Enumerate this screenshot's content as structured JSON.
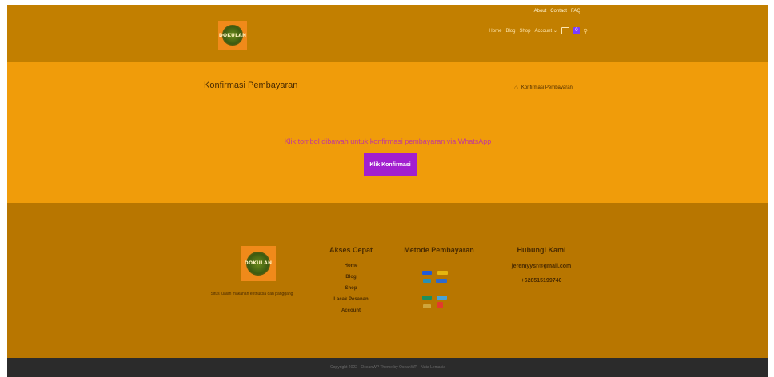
{
  "header": {
    "logo_text": "DOKULAN",
    "top_links": [
      "About",
      "Contact",
      "FAQ"
    ],
    "nav": [
      "Home",
      "Blog",
      "Shop",
      "Account"
    ],
    "cart_count": "0",
    "search_icon": "search-icon"
  },
  "content": {
    "title": "Konfirmasi Pembayaran",
    "breadcrumb": "Konfirmasi Pembayaran",
    "message": "Klik tombol dibawah untuk konfirmasi pembayaran via WhatsApp",
    "button_label": "Klik Konfirmasi"
  },
  "footer": {
    "logo_text": "DOKULAN",
    "tagline": "Situs jualan makanan enthuksa dan panggang",
    "quick_title": "Akses Cepat",
    "quick_links": [
      "Home",
      "Blog",
      "Shop",
      "Lacak Pesanan",
      "Account"
    ],
    "payment_title": "Metode Pembayaran",
    "payment_methods": [
      "bca",
      "mandiri",
      "bni",
      "danamon",
      "gopay",
      "ovo",
      "dana",
      "linkaja"
    ],
    "contact_title": "Hubungi Kami",
    "email": "jeremyysr@gmail.com",
    "phone": "+628515199740",
    "copyright": "Copyright 2022 · OceanWP Theme by OceanWP · Nata Lemasia"
  },
  "colors": {
    "header_bg": "#c27f00",
    "content_bg": "#f09c0a",
    "footer_bg": "#b87600",
    "button_bg": "#a21fcf",
    "message_color": "#c2389a",
    "copyright_bg": "#2b2b2b"
  }
}
